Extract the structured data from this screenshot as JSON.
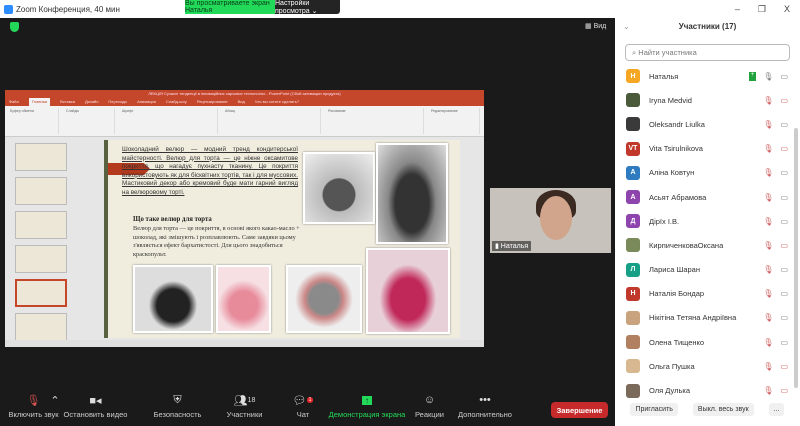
{
  "window": {
    "title": "Zoom Конференция, 40 мин",
    "viewing_banner": "Вы просматриваете экран Наталья",
    "view_options": "Настройки просмотра ⌄",
    "view_label": "Вид",
    "minimize": "–",
    "restore": "❐",
    "close": "X"
  },
  "presentation": {
    "title_bar": "ЛЕКЦІЯ Сучасні тенденції в інноваційних харчових технологіях - PowerPoint (Сбой активации продукта)",
    "tabs": [
      "Файл",
      "Главная",
      "Вставка",
      "Дизайн",
      "Переходы",
      "Анимация",
      "Слайд-шоу",
      "Рецензирование",
      "Вид",
      "Что вы хотите сделать?"
    ],
    "ribbon_groups": [
      "Буфер обмена",
      "Слайды",
      "Шрифт",
      "Абзац",
      "Рисование",
      "Редактирование"
    ],
    "slide": {
      "para1": "Шоколадний велюр — модний тренд кондитерської майстерності. Велюр для торта — це ніжне оксамитове покриття, що нагадує пухнасту тканину. Це покриття використовують як для бісквітних тортів, так і для муссових. Мастиковий декор або кремовий буде мати гарний вигляд на велюровому торті.",
      "heading": "Що таке велюр для торта",
      "para2": "Велюр для торта — це покриття, в основі якого какао-масло + шоколад, які змішують і розплавлюють. Саме завдяки цьому з'являється ефект бархатистості. Для цього знадобиться краскопульт."
    }
  },
  "video": {
    "name": "Наталья"
  },
  "toolbar": {
    "unmute": "Включить звук",
    "stop_video": "Остановить видео",
    "security": "Безопасность",
    "participants": "Участники",
    "participants_count": "18",
    "chat": "Чат",
    "chat_badge": "1",
    "share": "Демонстрация экрана",
    "reactions": "Реакции",
    "more": "Дополнительно",
    "end": "Завершение"
  },
  "sidebar": {
    "title": "Участники (17)",
    "search_placeholder": "Найти участника",
    "invite": "Пригласить",
    "mute_all": "Выкл. весь звук",
    "more": "...",
    "participants": [
      {
        "initial": "Н",
        "name": "Наталья",
        "color": "#f5a623",
        "host": true
      },
      {
        "initial": "",
        "name": "Iryna Medvid",
        "color": "#4a5a3a",
        "cam_off": true
      },
      {
        "initial": "",
        "name": "Oleksandr Liulka",
        "color": "#3a3a3a"
      },
      {
        "initial": "VT",
        "name": "Vita Tsirulnikova",
        "color": "#c0392b",
        "cam_off": true
      },
      {
        "initial": "А",
        "name": "Аліна Ковтун",
        "color": "#2e7bbf"
      },
      {
        "initial": "А",
        "name": "Асьят Абрамова",
        "color": "#8e44ad"
      },
      {
        "initial": "Д",
        "name": "Дірїх І.В.",
        "color": "#8e44ad"
      },
      {
        "initial": "",
        "name": "КирпиченковаОксана",
        "color": "#7a8a5a",
        "cam_off": true
      },
      {
        "initial": "Л",
        "name": "Лариса Шаран",
        "color": "#16a085"
      },
      {
        "initial": "Н",
        "name": "Наталія Бондар",
        "color": "#c0392b"
      },
      {
        "initial": "",
        "name": "Нікітіна Тетяна Андріївна",
        "color": "#c9a27e"
      },
      {
        "initial": "",
        "name": "Олена Тищенко",
        "color": "#b08060"
      },
      {
        "initial": "",
        "name": "Ольга Пушка",
        "color": "#d8b890",
        "cam_off": true
      },
      {
        "initial": "",
        "name": "Оля Дулька",
        "color": "#7a6a5a",
        "cam_off": true
      }
    ]
  }
}
